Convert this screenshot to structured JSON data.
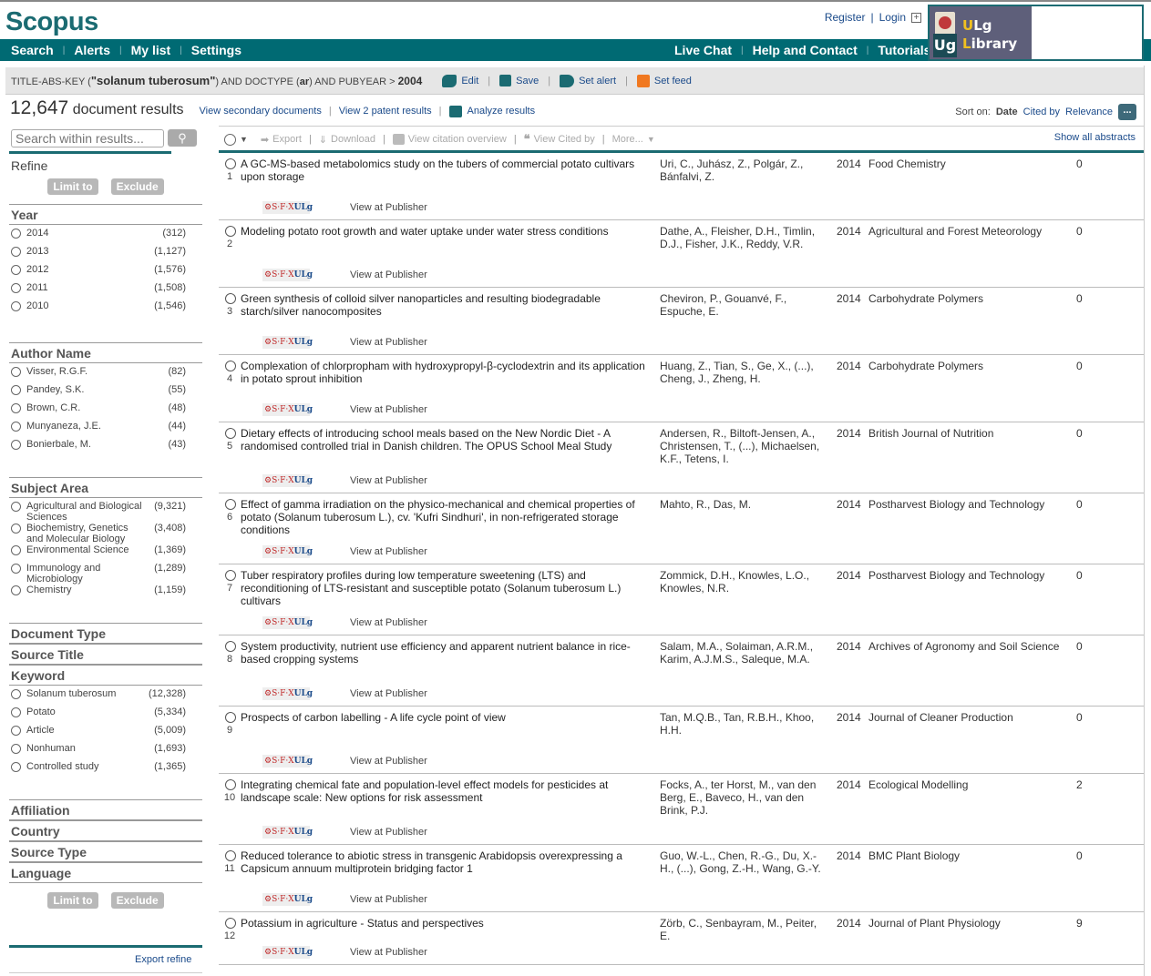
{
  "app": {
    "logo": "Scopus"
  },
  "nav": {
    "left": [
      "Search",
      "Alerts",
      "My list",
      "Settings"
    ],
    "right": [
      "Live Chat",
      "Help and Contact",
      "Tutorials"
    ],
    "register": "Register",
    "login": "Login",
    "library": {
      "line1_first": "U",
      "line1_rest": "Lg",
      "line2_first": "L",
      "line2_rest": "ibrary",
      "mark": "Ug"
    }
  },
  "query": {
    "prefix": "TITLE-ABS-KEY (",
    "term": "\"solanum tuberosum\"",
    "middle": ") AND DOCTYPE (",
    "doctype": "ar",
    "suffix": ") AND PUBYEAR  > ",
    "year": "2004",
    "actions": [
      "Edit",
      "Save",
      "Set alert",
      "Set feed"
    ]
  },
  "results": {
    "count": "12,647",
    "label": "document results",
    "links": [
      "View secondary documents",
      "View 2 patent results",
      "Analyze results"
    ],
    "sort_label": "Sort on:",
    "sort_options": [
      "Date",
      "Cited by",
      "Relevance"
    ],
    "sort_more": "..."
  },
  "search_within": {
    "placeholder": "Search within results...",
    "button_icon": "search-icon"
  },
  "toolbar": {
    "items": [
      "Export",
      "Download",
      "View citation overview",
      "View Cited by",
      "More..."
    ],
    "show_all": "Show all abstracts"
  },
  "sidebar": {
    "refine": "Refine",
    "limit_to": "Limit to",
    "exclude": "Exclude",
    "export_refine": "Export refine",
    "facets": [
      {
        "title": "Year",
        "items": [
          {
            "label": "2014",
            "count": "(312)"
          },
          {
            "label": "2013",
            "count": "(1,127)"
          },
          {
            "label": "2012",
            "count": "(1,576)"
          },
          {
            "label": "2011",
            "count": "(1,508)"
          },
          {
            "label": "2010",
            "count": "(1,546)"
          }
        ]
      },
      {
        "title": "Author Name",
        "items": [
          {
            "label": "Visser, R.G.F.",
            "count": "(82)"
          },
          {
            "label": "Pandey, S.K.",
            "count": "(55)"
          },
          {
            "label": "Brown, C.R.",
            "count": "(48)"
          },
          {
            "label": "Munyaneza, J.E.",
            "count": "(44)"
          },
          {
            "label": "Bonierbale, M.",
            "count": "(43)"
          }
        ]
      },
      {
        "title": "Subject Area",
        "items": [
          {
            "label": "Agricultural and Biological Sciences",
            "count": "(9,321)"
          },
          {
            "label": "Biochemistry, Genetics and Molecular Biology",
            "count": "(3,408)"
          },
          {
            "label": "Environmental Science",
            "count": "(1,369)"
          },
          {
            "label": "Immunology and Microbiology",
            "count": "(1,289)"
          },
          {
            "label": "Chemistry",
            "count": "(1,159)"
          }
        ]
      },
      {
        "title": "Document Type",
        "items": []
      },
      {
        "title": "Source Title",
        "items": []
      },
      {
        "title": "Keyword",
        "items": [
          {
            "label": "Solanum tuberosum",
            "count": "(12,328)"
          },
          {
            "label": "Potato",
            "count": "(5,334)"
          },
          {
            "label": "Article",
            "count": "(5,009)"
          },
          {
            "label": "Nonhuman",
            "count": "(1,693)"
          },
          {
            "label": "Controlled study",
            "count": "(1,365)"
          }
        ]
      },
      {
        "title": "Affiliation",
        "items": []
      },
      {
        "title": "Country",
        "items": []
      },
      {
        "title": "Source Type",
        "items": []
      },
      {
        "title": "Language",
        "items": []
      }
    ]
  },
  "documents": [
    {
      "num": "1",
      "title": "A GC-MS-based metabolomics study on the tubers of commercial potato cultivars upon storage",
      "authors": "Uri, C., Juhász, Z., Polgár, Z., Bánfalvi, Z.",
      "year": "2014",
      "source": "Food Chemistry",
      "cited": "0"
    },
    {
      "num": "2",
      "title": "Modeling potato root growth and water uptake under water stress conditions",
      "authors": "Dathe, A., Fleisher, D.H., Timlin, D.J., Fisher, J.K., Reddy, V.R.",
      "year": "2014",
      "source": "Agricultural and Forest Meteorology",
      "cited": "0"
    },
    {
      "num": "3",
      "title": "Green synthesis of colloid silver nanoparticles and resulting biodegradable starch/silver nanocomposites",
      "authors": "Cheviron, P., Gouanvé, F., Espuche, E.",
      "year": "2014",
      "source": "Carbohydrate Polymers",
      "cited": "0"
    },
    {
      "num": "4",
      "title": "Complexation of chlorpropham with hydroxypropyl-β-cyclodextrin and its application in potato sprout inhibition",
      "authors": "Huang, Z., Tian, S., Ge, X., (...), Cheng, J., Zheng, H.",
      "year": "2014",
      "source": "Carbohydrate Polymers",
      "cited": "0"
    },
    {
      "num": "5",
      "title": "Dietary effects of introducing school meals based on the New Nordic Diet - A randomised controlled trial in Danish children. The OPUS School Meal Study",
      "authors": "Andersen, R., Biltoft-Jensen, A., Christensen, T., (...), Michaelsen, K.F., Tetens, I.",
      "year": "2014",
      "source": "British Journal of Nutrition",
      "cited": "0"
    },
    {
      "num": "6",
      "title": "Effect of gamma irradiation on the physico-mechanical and chemical properties of potato (Solanum tuberosum L.), cv. 'Kufri Sindhuri', in non-refrigerated storage conditions",
      "authors": "Mahto, R., Das, M.",
      "year": "2014",
      "source": "Postharvest Biology and Technology",
      "cited": "0"
    },
    {
      "num": "7",
      "title": "Tuber respiratory profiles during low temperature sweetening (LTS) and reconditioning of LTS-resistant and susceptible potato (Solanum tuberosum L.) cultivars",
      "authors": "Zommick, D.H., Knowles, L.O., Knowles, N.R.",
      "year": "2014",
      "source": "Postharvest Biology and Technology",
      "cited": "0"
    },
    {
      "num": "8",
      "title": "System productivity, nutrient use efficiency and apparent nutrient balance in rice-based cropping systems",
      "authors": "Salam, M.A., Solaiman, A.R.M., Karim, A.J.M.S., Saleque, M.A.",
      "year": "2014",
      "source": "Archives of Agronomy and Soil Science",
      "cited": "0"
    },
    {
      "num": "9",
      "title": "Prospects of carbon labelling - A life cycle point of view",
      "authors": "Tan, M.Q.B., Tan, R.B.H., Khoo, H.H.",
      "year": "2014",
      "source": "Journal of Cleaner Production",
      "cited": "0"
    },
    {
      "num": "10",
      "title": "Integrating chemical fate and population-level effect models for pesticides at landscape scale: New options for risk assessment",
      "authors": "Focks, A., ter Horst, M., van den Berg, E., Baveco, H., van den Brink, P.J.",
      "year": "2014",
      "source": "Ecological Modelling",
      "cited": "2"
    },
    {
      "num": "11",
      "title": "Reduced tolerance to abiotic stress in transgenic Arabidopsis overexpressing a Capsicum annuum multiprotein bridging factor 1",
      "authors": "Guo, W.-L., Chen, R.-G., Du, X.-H., (...), Gong, Z.-H., Wang, G.-Y.",
      "year": "2014",
      "source": "BMC Plant Biology",
      "cited": "0"
    },
    {
      "num": "12",
      "title": "Potassium in agriculture - Status and perspectives",
      "authors": "Zörb, C., Senbayram, M., Peiter, E.",
      "year": "2014",
      "source": "Journal of Plant Physiology",
      "cited": "9"
    }
  ],
  "row_common": {
    "sfx_text": "S·F·X",
    "sfx_ulg": "ULg",
    "view_publisher": "View at Publisher"
  },
  "colors": {
    "brand": "#006a73",
    "link": "#1a4a8a",
    "rss": "#f07820"
  }
}
